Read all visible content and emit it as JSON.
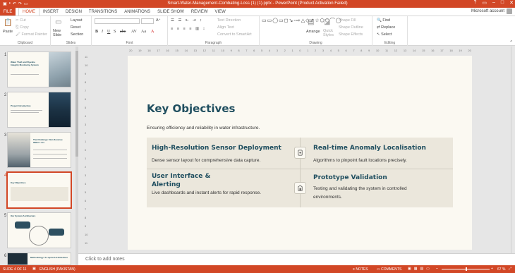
{
  "window": {
    "title": "Smart-Water-Management-Combating-Loss (1) (1).pptx - PowerPoint (Product Activation Failed)"
  },
  "tabs": {
    "file": "FILE",
    "items": [
      "HOME",
      "INSERT",
      "DESIGN",
      "TRANSITIONS",
      "ANIMATIONS",
      "SLIDE SHOW",
      "REVIEW",
      "VIEW"
    ],
    "account": "Microsoft account"
  },
  "ribbon": {
    "clipboard": {
      "paste": "Paste",
      "cut": "Cut",
      "copy": "Copy",
      "format_painter": "Format Painter",
      "label": "Clipboard"
    },
    "slides": {
      "new_slide": "New Slide",
      "layout": "Layout",
      "reset": "Reset",
      "section": "Section",
      "label": "Slides"
    },
    "font": {
      "label": "Font"
    },
    "paragraph": {
      "text_direction": "Text Direction",
      "align_text": "Align Text",
      "convert": "Convert to SmartArt",
      "label": "Paragraph"
    },
    "drawing": {
      "arrange": "Arrange",
      "quick_styles": "Quick Styles",
      "shape_fill": "Shape Fill",
      "shape_outline": "Shape Outline",
      "shape_effects": "Shape Effects",
      "label": "Drawing"
    },
    "editing": {
      "find": "Find",
      "replace": "Replace",
      "select": "Select",
      "label": "Editing"
    }
  },
  "ruler": {
    "ticks": [
      "20",
      "19",
      "18",
      "17",
      "16",
      "15",
      "14",
      "13",
      "12",
      "11",
      "10",
      "9",
      "8",
      "7",
      "6",
      "5",
      "4",
      "3",
      "2",
      "1",
      "0",
      "1",
      "2",
      "3",
      "4",
      "5",
      "6",
      "7",
      "8",
      "9",
      "10",
      "11",
      "12",
      "13",
      "14",
      "15",
      "16",
      "17",
      "18",
      "19",
      "20"
    ],
    "vticks": [
      "11",
      "10",
      "9",
      "8",
      "7",
      "6",
      "5",
      "4",
      "3",
      "2",
      "1",
      "0",
      "1",
      "2",
      "3",
      "4",
      "5",
      "6",
      "7",
      "8",
      "9",
      "10",
      "11"
    ]
  },
  "thumbnails": [
    {
      "num": "1",
      "title": "Water Theft and Pipeline Integrity Monitoring System"
    },
    {
      "num": "2",
      "title": "Project Introduction"
    },
    {
      "num": "3",
      "title": "The Challenge: Non-Revenue Water Loss"
    },
    {
      "num": "4",
      "title": "Key Objectives"
    },
    {
      "num": "5",
      "title": "Our System Architecture"
    },
    {
      "num": "6",
      "title": "Methodology: 5-Layered Architecture"
    }
  ],
  "slide": {
    "title": "Key Objectives",
    "subtitle": "Ensuring efficiency and reliability in water infrastructure.",
    "cards": [
      {
        "heading": "High-Resolution Sensor Deployment",
        "desc": "Dense sensor layout for comprehensive data capture."
      },
      {
        "heading": "Real-time Anomaly Localisation",
        "desc": "Algorithms to pinpoint fault locations precisely."
      },
      {
        "heading": "User Interface & Alerting",
        "desc": "Live dashboards and instant alerts for rapid response."
      },
      {
        "heading": "Prototype Validation",
        "desc": "Testing and validating the system in controlled environments."
      }
    ]
  },
  "notes": {
    "placeholder": "Click to add notes"
  },
  "status": {
    "slide": "SLIDE 4 OF 11",
    "language": "ENGLISH (PAKISTAN)",
    "notes": "NOTES",
    "comments": "COMMENTS",
    "zoom": "67 %"
  }
}
